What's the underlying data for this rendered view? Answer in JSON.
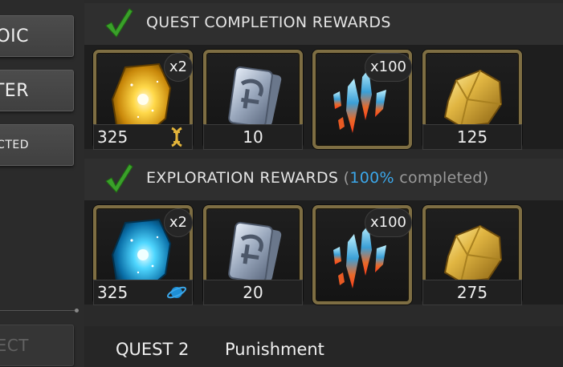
{
  "side_menu": {
    "buttons": [
      {
        "label": "ROIC",
        "enabled": true
      },
      {
        "label": "STER",
        "enabled": true
      },
      {
        "label": "LLECTED",
        "enabled": true
      },
      {
        "label": "LECT",
        "enabled": false
      }
    ]
  },
  "quest_rewards": {
    "title": "QUEST COMPLETION REWARDS",
    "items": [
      {
        "icon": "yellow-crystal-shard-icon",
        "badge": "x2",
        "quantity": "325",
        "class_icon": "dna-science-icon"
      },
      {
        "icon": "silver-sigil-cards-icon",
        "badge": "",
        "quantity": "10"
      },
      {
        "icon": "blue-red-crystals-icon",
        "badge": "x100",
        "quantity": ""
      },
      {
        "icon": "gold-ore-icon",
        "badge": "",
        "quantity": "125"
      }
    ]
  },
  "exploration_rewards": {
    "title": "EXPLORATION REWARDS",
    "paren_open": "(",
    "percent": "100%",
    "completed_text": " completed)",
    "items": [
      {
        "icon": "blue-crystal-shard-icon",
        "badge": "x2",
        "quantity": "325",
        "class_icon": "planet-cosmic-icon"
      },
      {
        "icon": "silver-sigil-cards-icon",
        "badge": "",
        "quantity": "20"
      },
      {
        "icon": "blue-red-crystals-icon",
        "badge": "x100",
        "quantity": ""
      },
      {
        "icon": "gold-ore-icon",
        "badge": "",
        "quantity": "275"
      }
    ]
  },
  "next_quest": {
    "number": "QUEST 2",
    "name": "Punishment"
  },
  "colors": {
    "accent_blue": "#3ba7ea",
    "check_green": "#3aa02a",
    "frame_gold": "#7e6e43"
  }
}
